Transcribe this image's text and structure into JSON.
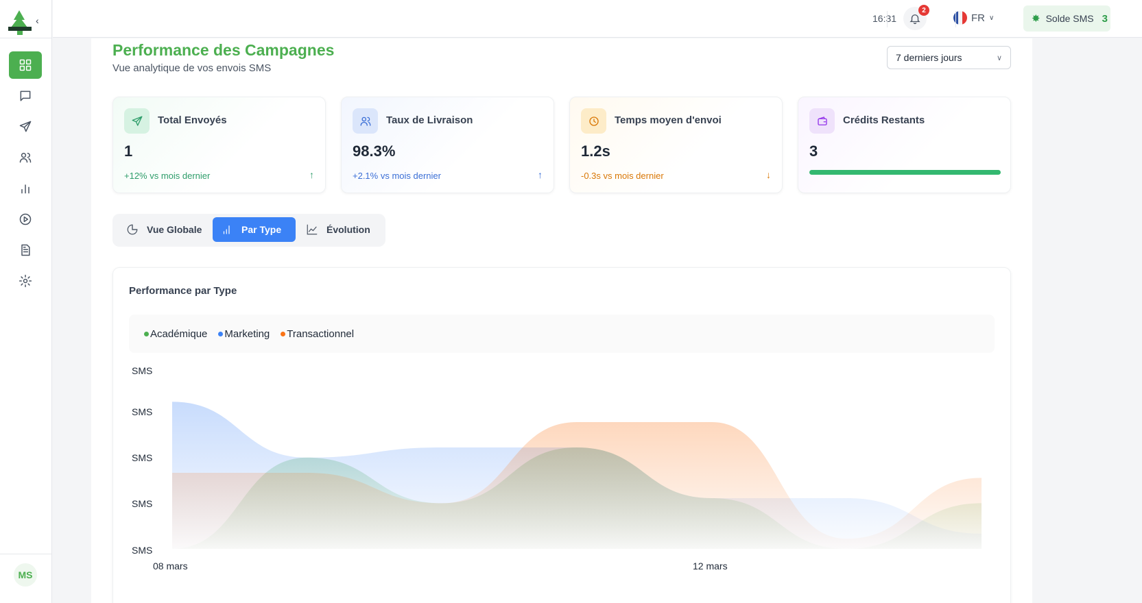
{
  "sidebar": {
    "items": [
      {
        "name": "dashboard",
        "icon": "grid-icon",
        "active": true
      },
      {
        "name": "messages",
        "icon": "message-icon",
        "active": false
      },
      {
        "name": "send",
        "icon": "send-icon",
        "active": false
      },
      {
        "name": "contacts",
        "icon": "users-icon",
        "active": false
      },
      {
        "name": "stats",
        "icon": "bar-chart-icon",
        "active": false
      },
      {
        "name": "play",
        "icon": "play-circle-icon",
        "active": false
      },
      {
        "name": "documents",
        "icon": "document-icon",
        "active": false
      },
      {
        "name": "settings",
        "icon": "gear-icon",
        "active": false
      }
    ],
    "avatar_initials": "MS"
  },
  "header": {
    "time": "16:31",
    "notifications_count": "2",
    "language": "FR",
    "sms_balance_label": "Solde SMS",
    "sms_balance_value": "3"
  },
  "page": {
    "title": "Performance des Campagnes",
    "subtitle": "Vue analytique de vos envois SMS",
    "period": "7 derniers jours"
  },
  "kpis": [
    {
      "label": "Total Envoyés",
      "value": "1",
      "trend": "+12% vs mois dernier",
      "trend_direction": "up",
      "color": "#2e9d6a",
      "icon": "send-icon"
    },
    {
      "label": "Taux de Livraison",
      "value": "98.3%",
      "trend": "+2.1% vs mois dernier",
      "trend_direction": "up",
      "color": "#3b6fd6",
      "icon": "users-icon"
    },
    {
      "label": "Temps moyen d'envoi",
      "value": "1.2s",
      "trend": "-0.3s vs mois dernier",
      "trend_direction": "down",
      "color": "#d97706",
      "icon": "clock-icon"
    },
    {
      "label": "Crédits Restants",
      "value": "3",
      "progress": 1.0,
      "color": "#9333ea",
      "icon": "wallet-icon"
    }
  ],
  "tabs": [
    {
      "label": "Vue Globale",
      "icon": "pie-icon",
      "active": false
    },
    {
      "label": "Par Type",
      "icon": "bar-chart-icon",
      "active": true
    },
    {
      "label": "Évolution",
      "icon": "line-chart-icon",
      "active": false
    }
  ],
  "chart_data": {
    "type": "area",
    "title": "Performance par Type",
    "y_tick_labels": [
      "SMS",
      "SMS",
      "SMS",
      "SMS",
      "SMS"
    ],
    "x_tick_labels": [
      "08 mars",
      "12 mars"
    ],
    "legend_placement": "top-left",
    "series": [
      {
        "name": "Académique",
        "color": "#4caf50",
        "values": [
          0.0,
          1.8,
          0.9,
          2.0,
          1.0,
          0.0,
          0.9
        ]
      },
      {
        "name": "Marketing",
        "color": "#3b82f6",
        "values": [
          2.9,
          1.8,
          2.0,
          2.0,
          1.0,
          1.0,
          0.3
        ]
      },
      {
        "name": "Transactionnel",
        "color": "#f97316",
        "values": [
          1.5,
          1.5,
          0.9,
          2.5,
          2.5,
          0.2,
          1.4
        ]
      }
    ]
  }
}
